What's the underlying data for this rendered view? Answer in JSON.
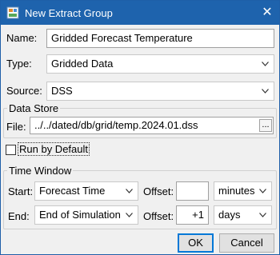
{
  "window": {
    "title": "New Extract Group",
    "close_glyph": "✕",
    "icon": "app-icon"
  },
  "form": {
    "name_label": "Name:",
    "name_value": "Gridded Forecast Temperature",
    "type_label": "Type:",
    "type_value": "Gridded Data",
    "source_label": "Source:",
    "source_value": "DSS"
  },
  "data_store": {
    "group_title": "Data Store",
    "file_label": "File:",
    "file_value": "../../dated/db/grid/temp.2024.01.dss",
    "browse_label": "..."
  },
  "run_by_default": {
    "label": "Run by Default",
    "checked": false
  },
  "time_window": {
    "group_title": "Time Window",
    "start_label": "Start:",
    "start_value": "Forecast Time",
    "start_offset_label": "Offset:",
    "start_offset_value": "",
    "start_unit": "minutes",
    "end_label": "End:",
    "end_value": "End of Simulation",
    "end_offset_label": "Offset:",
    "end_offset_value": "+1",
    "end_unit": "days"
  },
  "buttons": {
    "ok": "OK",
    "cancel": "Cancel"
  },
  "colors": {
    "titlebar": "#1e63ad",
    "focus_border": "#0078d7"
  }
}
